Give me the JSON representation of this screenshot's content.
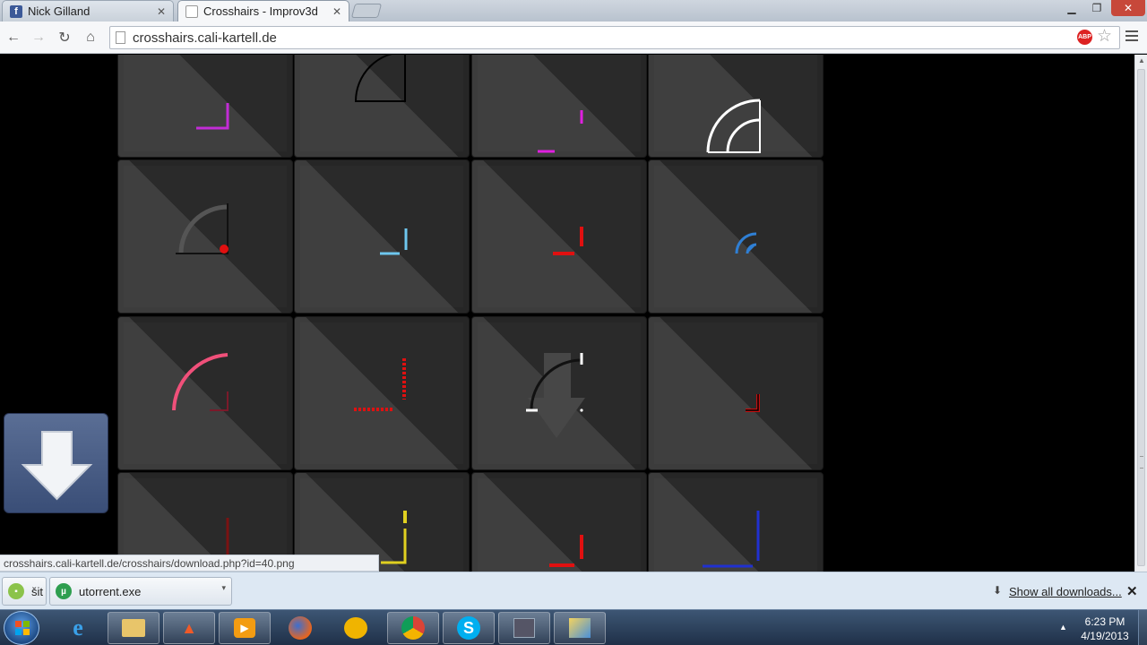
{
  "browser": {
    "tabs": [
      {
        "label": "Nick Gilland",
        "icon": "facebook-icon",
        "active": false
      },
      {
        "label": "Crosshairs - Improv3d",
        "icon": "page-icon",
        "active": true
      }
    ],
    "url": "crosshairs.cali-kartell.de",
    "abp_badge": "ABP"
  },
  "page": {
    "tile_colors": [
      "#c22cd6",
      "#000000",
      "#e020e0",
      "#ffffff",
      "#e01010",
      "#6ec7ef",
      "#e01010",
      "#2f7fd4",
      "#f0507a",
      "#e01010",
      "#ffffff",
      "#e01010",
      "#c01010",
      "#e0d020",
      "#e01010",
      "#2030d0"
    ]
  },
  "status_url": "crosshairs.cali-kartell.de/crosshairs/download.php?id=40.png",
  "downloads": {
    "items": [
      {
        "label": "šit",
        "icon": "file-icon"
      },
      {
        "label": "utorrent.exe",
        "icon": "utorrent-icon"
      }
    ],
    "show_all": "Show all downloads...",
    "close": "✕"
  },
  "taskbar": {
    "apps": [
      "internet-explorer-icon",
      "file-explorer-icon",
      "app-icon",
      "media-player-icon",
      "firefox-icon",
      "app-icon",
      "chrome-icon",
      "skype-icon",
      "media-icon",
      "paint-icon"
    ],
    "time": "6:23 PM",
    "date": "4/19/2013"
  }
}
